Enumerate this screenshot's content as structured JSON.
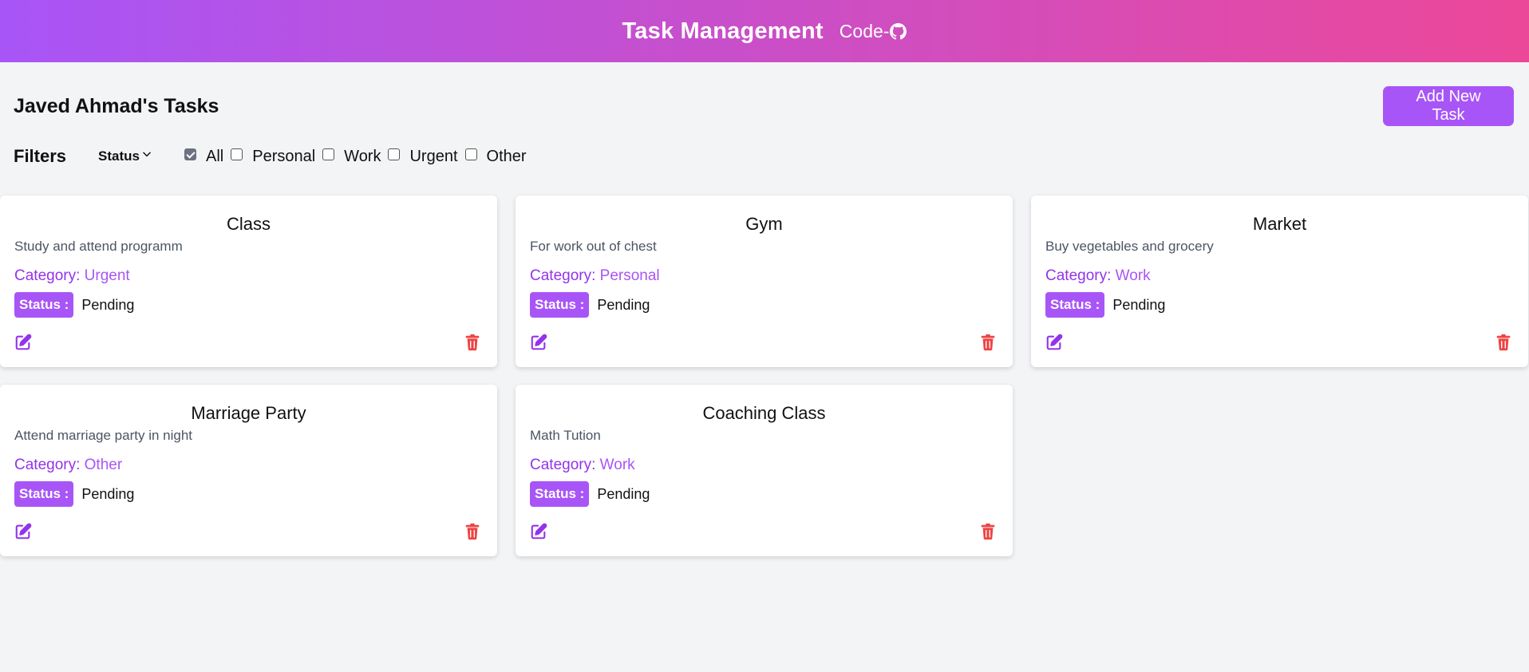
{
  "header": {
    "title": "Task Management",
    "code_label": "Code-"
  },
  "page": {
    "title": "Javed Ahmad's Tasks",
    "add_button": "Add New Task"
  },
  "filters": {
    "label": "Filters",
    "status_dropdown": "Status",
    "categories": [
      {
        "label": "All",
        "checked": true
      },
      {
        "label": "Personal",
        "checked": false
      },
      {
        "label": "Work",
        "checked": false
      },
      {
        "label": "Urgent",
        "checked": false
      },
      {
        "label": "Other",
        "checked": false
      }
    ]
  },
  "labels": {
    "category_prefix": "Category: ",
    "status_prefix": "Status :"
  },
  "tasks": [
    {
      "title": "Class",
      "description": "Study and attend programm",
      "category": "Urgent",
      "status": "Pending"
    },
    {
      "title": "Gym",
      "description": "For work out of chest",
      "category": "Personal",
      "status": "Pending"
    },
    {
      "title": "Market",
      "description": "Buy vegetables and grocery",
      "category": "Work",
      "status": "Pending"
    },
    {
      "title": "Marriage Party",
      "description": "Attend marriage party in night",
      "category": "Other",
      "status": "Pending"
    },
    {
      "title": "Coaching Class",
      "description": "Math Tution",
      "category": "Work",
      "status": "Pending"
    }
  ],
  "colors": {
    "accent": "#a855f7",
    "gradient_start": "#a855f7",
    "gradient_end": "#ec4899",
    "delete": "#ef4444",
    "background": "#f3f4f6"
  },
  "icons": {
    "github": "github-icon",
    "status_chevron": "chevron-down-icon",
    "edit": "edit-icon",
    "delete": "trash-icon"
  }
}
